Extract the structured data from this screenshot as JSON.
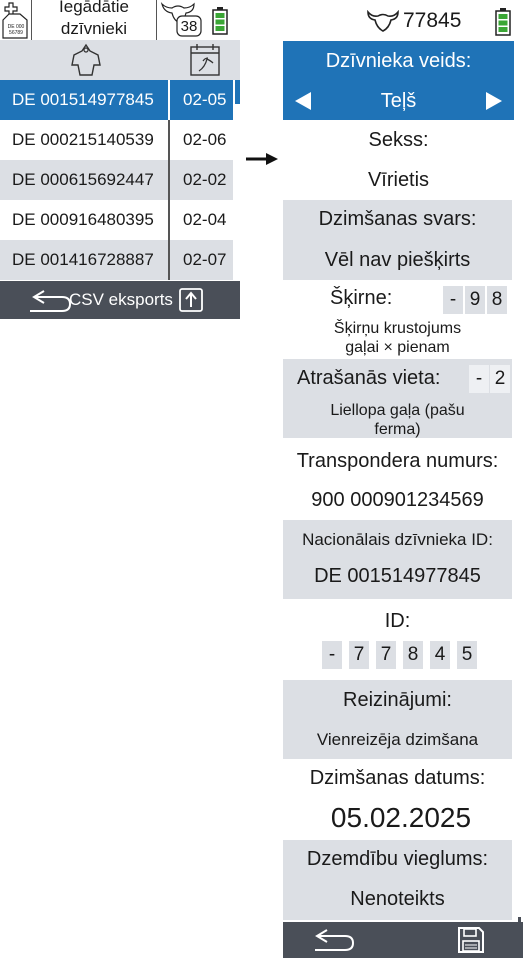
{
  "left": {
    "header": {
      "title_line1": "Iegādātie",
      "title_line2": "dzīvnieki",
      "tag_icon_text": "DE 000 56789",
      "cow_count": "38"
    },
    "rows": [
      {
        "id": "DE 001514977845",
        "date": "02-05",
        "selected": true
      },
      {
        "id": "DE 000215140539",
        "date": "02-06",
        "selected": false
      },
      {
        "id": "DE 000615692447",
        "date": "02-02",
        "selected": false
      },
      {
        "id": "DE 000916480395",
        "date": "02-04",
        "selected": false
      },
      {
        "id": "DE 001416728887",
        "date": "02-07",
        "selected": false
      }
    ],
    "footer": {
      "export_label": "CSV eksports"
    }
  },
  "right": {
    "header": {
      "animal_id": "77845"
    },
    "animal_type": {
      "label": "Dzīvnieka veids:",
      "value": "Teļš"
    },
    "sex": {
      "label": "Sekss:",
      "value": "Vīrietis"
    },
    "birth_weight": {
      "label": "Dzimšanas svars:",
      "value": "Vēl nav piešķirts"
    },
    "breed": {
      "label": "Šķirne:",
      "digits": [
        "-",
        "9",
        "8"
      ],
      "desc_line1": "Šķirņu krustojums",
      "desc_line2": "gaļai × pienam"
    },
    "location": {
      "label": "Atrašanās vieta:",
      "digits": [
        "-",
        "2"
      ],
      "desc_line1": "Liellopa gaļa (pašu",
      "desc_line2": "ferma)"
    },
    "transponder": {
      "label": "Transpondera numurs:",
      "value": "900 000901234569"
    },
    "national_id": {
      "label": "Nacionālais dzīvnieka ID:",
      "value": "DE 001514977845"
    },
    "id": {
      "label": "ID:",
      "digits": [
        "-",
        "7",
        "7",
        "8",
        "4",
        "5"
      ]
    },
    "multiples": {
      "label": "Reizinājumi:",
      "value": "Vienreizēja dzimšana"
    },
    "birth_date": {
      "label": "Dzimšanas datums:",
      "value": "05.02.2025"
    },
    "calving_ease": {
      "label": "Dzemdību vieglums:",
      "value": "Nenoteikts"
    }
  },
  "colors": {
    "selected": "#1f73b7",
    "row_grey": "#dcdfe4",
    "footer": "#4a4f58",
    "battery": "#3aa635"
  }
}
